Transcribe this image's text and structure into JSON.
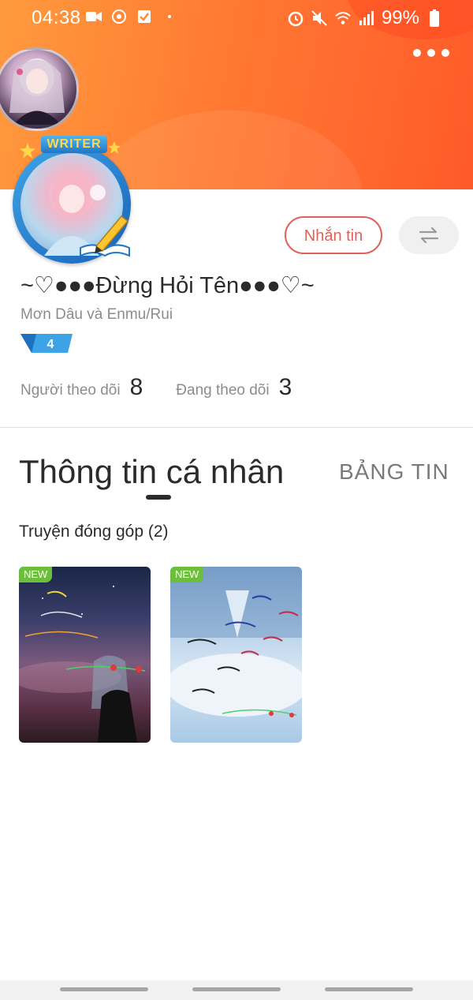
{
  "status_bar": {
    "time": "04:38",
    "battery": "99%",
    "left_icons": [
      "video-icon",
      "sync-icon",
      "check-icon",
      "dot-icon"
    ],
    "right_icons": [
      "alarm-icon",
      "mute-icon",
      "wifi-icon",
      "signal-icon",
      "battery-icon"
    ]
  },
  "header": {
    "writer_badge": "WRITER",
    "more_icon": "more-dots-icon"
  },
  "actions": {
    "message_label": "Nhắn tin",
    "swap_icon": "swap-icon"
  },
  "profile": {
    "name": "~♡●●●Đừng Hỏi Tên●●●♡~",
    "bio": "Mơn Dâu và Enmu/Rui",
    "level": "4"
  },
  "stats": {
    "followers_label": "Người theo dõi",
    "followers_value": "8",
    "following_label": "Đang theo dõi",
    "following_value": "3"
  },
  "tabs": {
    "info": "Thông tin cá nhân",
    "feed": "BẢNG TIN"
  },
  "section": {
    "title": "Truyện đóng góp (2)"
  },
  "books": [
    {
      "tag": "NEW"
    },
    {
      "tag": "NEW"
    }
  ],
  "colors": {
    "header_start": "#ff9a3e",
    "header_end": "#ff5a2a",
    "accent": "#e0615a",
    "new_tag": "#6cbf3a"
  }
}
